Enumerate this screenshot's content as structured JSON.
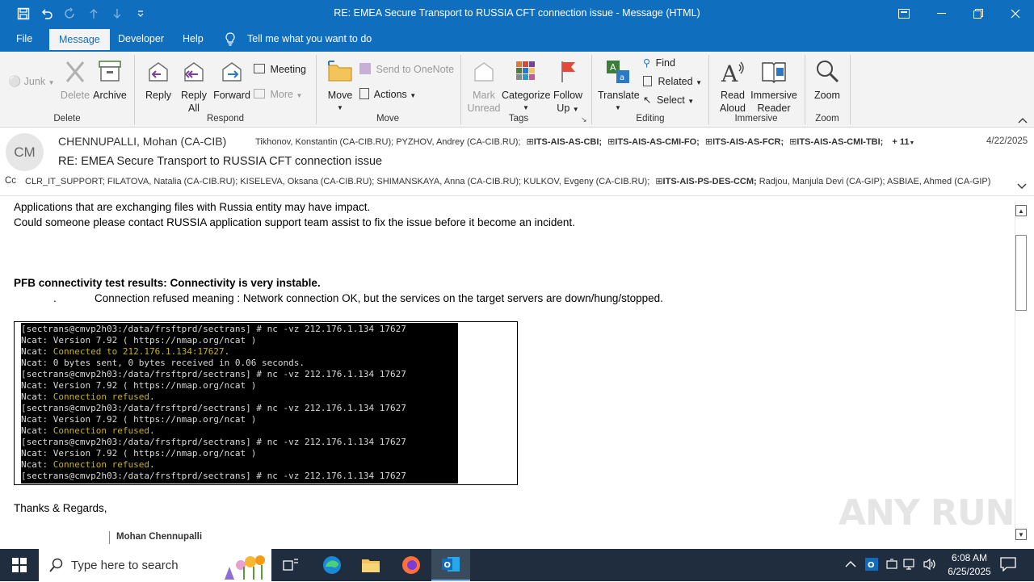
{
  "window": {
    "title": "RE: EMEA Secure Transport to RUSSIA CFT connection issue  -  Message (HTML)"
  },
  "menu": {
    "items": [
      "File",
      "Message",
      "Developer",
      "Help"
    ],
    "active": "Message",
    "tell_me": "Tell me what you want to do"
  },
  "ribbon": {
    "delete_group": {
      "junk": "Junk",
      "delete": "Delete",
      "archive": "Archive",
      "label": "Delete"
    },
    "respond_group": {
      "reply": "Reply",
      "reply_all_1": "Reply",
      "reply_all_2": "All",
      "forward": "Forward",
      "meeting": "Meeting",
      "more": "More",
      "label": "Respond"
    },
    "move_group": {
      "move": "Move",
      "send_onenote": "Send to OneNote",
      "actions": "Actions",
      "label": "Move"
    },
    "tags_group": {
      "mark_unread_1": "Mark",
      "mark_unread_2": "Unread",
      "categorize": "Categorize",
      "follow_up_1": "Follow",
      "follow_up_2": "Up",
      "label": "Tags"
    },
    "editing_group": {
      "translate": "Translate",
      "find": "Find",
      "related": "Related",
      "select": "Select",
      "label": "Editing"
    },
    "immersive_group": {
      "read_aloud_1": "Read",
      "read_aloud_2": "Aloud",
      "immersive_1": "Immersive",
      "immersive_2": "Reader",
      "label": "Immersive"
    },
    "zoom_group": {
      "zoom": "Zoom",
      "label": "Zoom"
    }
  },
  "header": {
    "avatar_initials": "CM",
    "sender": "CHENNUPALLI, Mohan (CA-CIB)",
    "to_plain": "Tikhonov, Konstantin (CA-CIB.RU); PYZHOV, Andrey (CA-CIB.RU);",
    "to_groups": [
      "ITS-AIS-AS-CBI;",
      "ITS-AIS-AS-CMI-FO;",
      "ITS-AIS-AS-FCR;",
      "ITS-AIS-AS-CMI-TBI;"
    ],
    "more_count": "+ 11",
    "date": "4/22/2025",
    "subject": "RE: EMEA Secure Transport to RUSSIA CFT connection issue",
    "cc_label": "Cc",
    "cc_plain": "CLR_IT_SUPPORT; FILATOVA, Natalia (CA-CIB.RU); KISELEVA, Oksana (CA-CIB.RU); SHIMANSKAYA, Anna (CA-CIB.RU); KULKOV, Evgeny (CA-CIB.RU);",
    "cc_group": "ITS-AIS-PS-DES-CCM;",
    "cc_rest": "Radjou, Manjula Devi (CA-GIP); ASBIAE, Ahmed (CA-GIP)"
  },
  "body": {
    "line1": "Applications that are exchanging files with Russia entity may have impact.",
    "line2": "Could someone please contact RUSSIA application support team assist to fix the issue before it become an incident.",
    "pfb_heading": "PFB connectivity test results: Connectivity is very instable.",
    "bullet": ".",
    "bullet_text": "Connection refused meaning : Network connection OK, but the services on the target servers are down/hung/stopped.",
    "regards": "Thanks & Regards,",
    "signature": "Mohan Chennupalli"
  },
  "terminal": {
    "lines": [
      {
        "pre": "[sectrans@cmvp2h03:/data/frsftprd/sectrans] # nc -vz 212.176.1.134 17627",
        "hl": "",
        "post": ""
      },
      {
        "pre": "Ncat: Version 7.92 ( https://nmap.org/ncat )",
        "hl": "",
        "post": ""
      },
      {
        "pre": "Ncat: ",
        "hl": "Connected to 212.176.1.134:17627",
        "post": "."
      },
      {
        "pre": "Ncat: 0 bytes sent, 0 bytes received in 0.06 seconds.",
        "hl": "",
        "post": ""
      },
      {
        "pre": "[sectrans@cmvp2h03:/data/frsftprd/sectrans] # nc -vz 212.176.1.134 17627",
        "hl": "",
        "post": ""
      },
      {
        "pre": "Ncat: Version 7.92 ( https://nmap.org/ncat )",
        "hl": "",
        "post": ""
      },
      {
        "pre": "Ncat: ",
        "hl": "Connection refused",
        "post": "."
      },
      {
        "pre": "[sectrans@cmvp2h03:/data/frsftprd/sectrans] # nc -vz 212.176.1.134 17627",
        "hl": "",
        "post": ""
      },
      {
        "pre": "Ncat: Version 7.92 ( https://nmap.org/ncat )",
        "hl": "",
        "post": ""
      },
      {
        "pre": "Ncat: ",
        "hl": "Connection refused",
        "post": "."
      },
      {
        "pre": "[sectrans@cmvp2h03:/data/frsftprd/sectrans] # nc -vz 212.176.1.134 17627",
        "hl": "",
        "post": ""
      },
      {
        "pre": "Ncat: Version 7.92 ( https://nmap.org/ncat )",
        "hl": "",
        "post": ""
      },
      {
        "pre": "Ncat: ",
        "hl": "Connection refused",
        "post": "."
      },
      {
        "pre": "[sectrans@cmvp2h03:/data/frsftprd/sectrans] # nc -vz 212.176.1.134 17627",
        "hl": "",
        "post": ""
      }
    ]
  },
  "watermark": "ANY RUN",
  "taskbar": {
    "search_placeholder": "Type here to search",
    "time": "6:08 AM",
    "date": "6/25/2025"
  },
  "colors": {
    "accent": "#106ebe",
    "ribbon_bg": "#f3f3f3",
    "terminal_highlight": "#c8b400",
    "taskbar_bg": "#202d3e"
  }
}
